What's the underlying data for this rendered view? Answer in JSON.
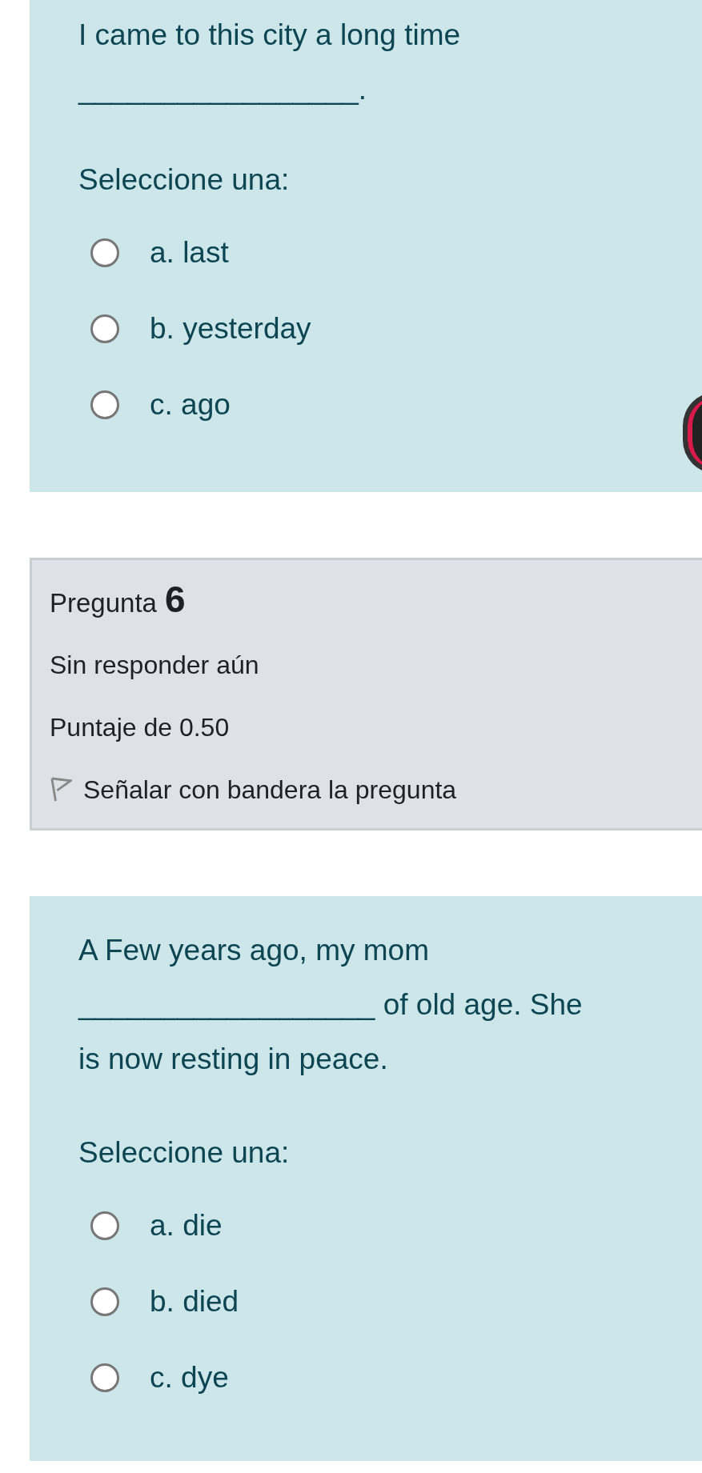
{
  "questions_before": [
    {
      "text": "I came to this city a long time _________________.",
      "prompt": "Seleccione una:",
      "options": [
        {
          "label": "a. last",
          "selected": false
        },
        {
          "label": "b. yesterday",
          "selected": false
        },
        {
          "label": "c. ago",
          "selected": false
        }
      ]
    }
  ],
  "info": {
    "label": "Pregunta",
    "number": "6",
    "status": "Sin responder aún",
    "score": "Puntaje de 0.50",
    "flag": {
      "label": "Señalar con bandera la pregunta",
      "flagged": false
    }
  },
  "question": {
    "text": "A Few years ago, my mom __________________ of old age. She is now resting in peace.",
    "prompt": "Seleccione una:",
    "options": [
      {
        "label": "a. die",
        "selected": false
      },
      {
        "label": "b. died",
        "selected": false
      },
      {
        "label": "c. dye",
        "selected": false
      }
    ]
  }
}
